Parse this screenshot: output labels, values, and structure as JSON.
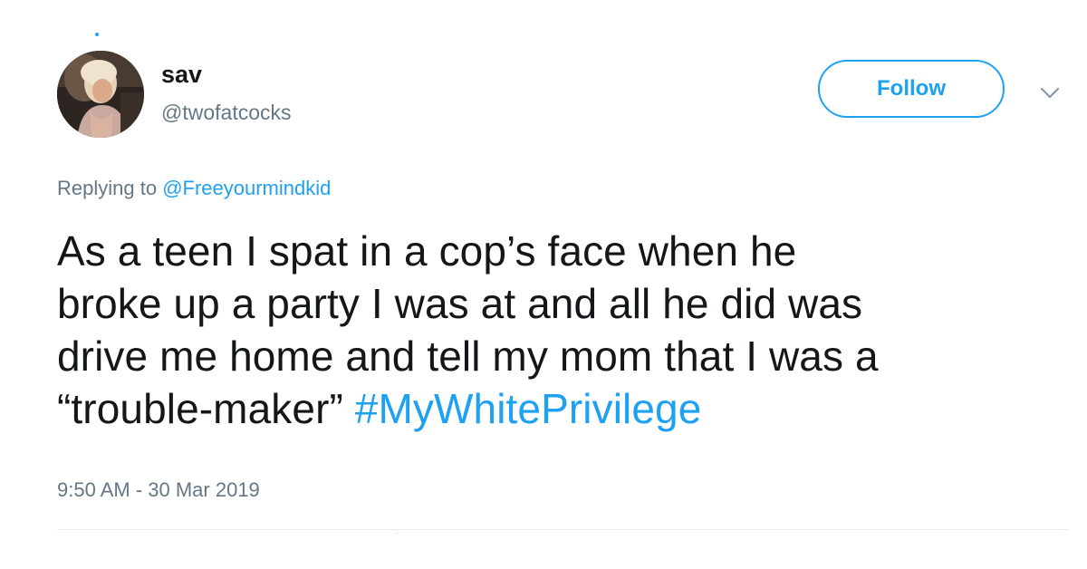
{
  "user": {
    "display_name": "sav",
    "handle": "@twofatcocks",
    "avatar": "profile-photo"
  },
  "follow_button": {
    "label": "Follow"
  },
  "menu": {
    "icon": "chevron-down-icon"
  },
  "reply": {
    "prefix": "Replying to ",
    "mention": "@Freeyourmindkid"
  },
  "tweet": {
    "lines": [
      "As a teen I spat in a cop’s face when he",
      "broke up a party I was at and all he did was",
      "drive me home and tell my mom that I was a",
      "“trouble-maker” "
    ],
    "hashtag": "#MyWhitePrivilege"
  },
  "timestamp": "9:50 AM - 30 Mar 2019",
  "colors": {
    "accent": "#1da1f2",
    "text": "#14171a",
    "secondary": "#657786",
    "divider": "#e6ecf0"
  }
}
